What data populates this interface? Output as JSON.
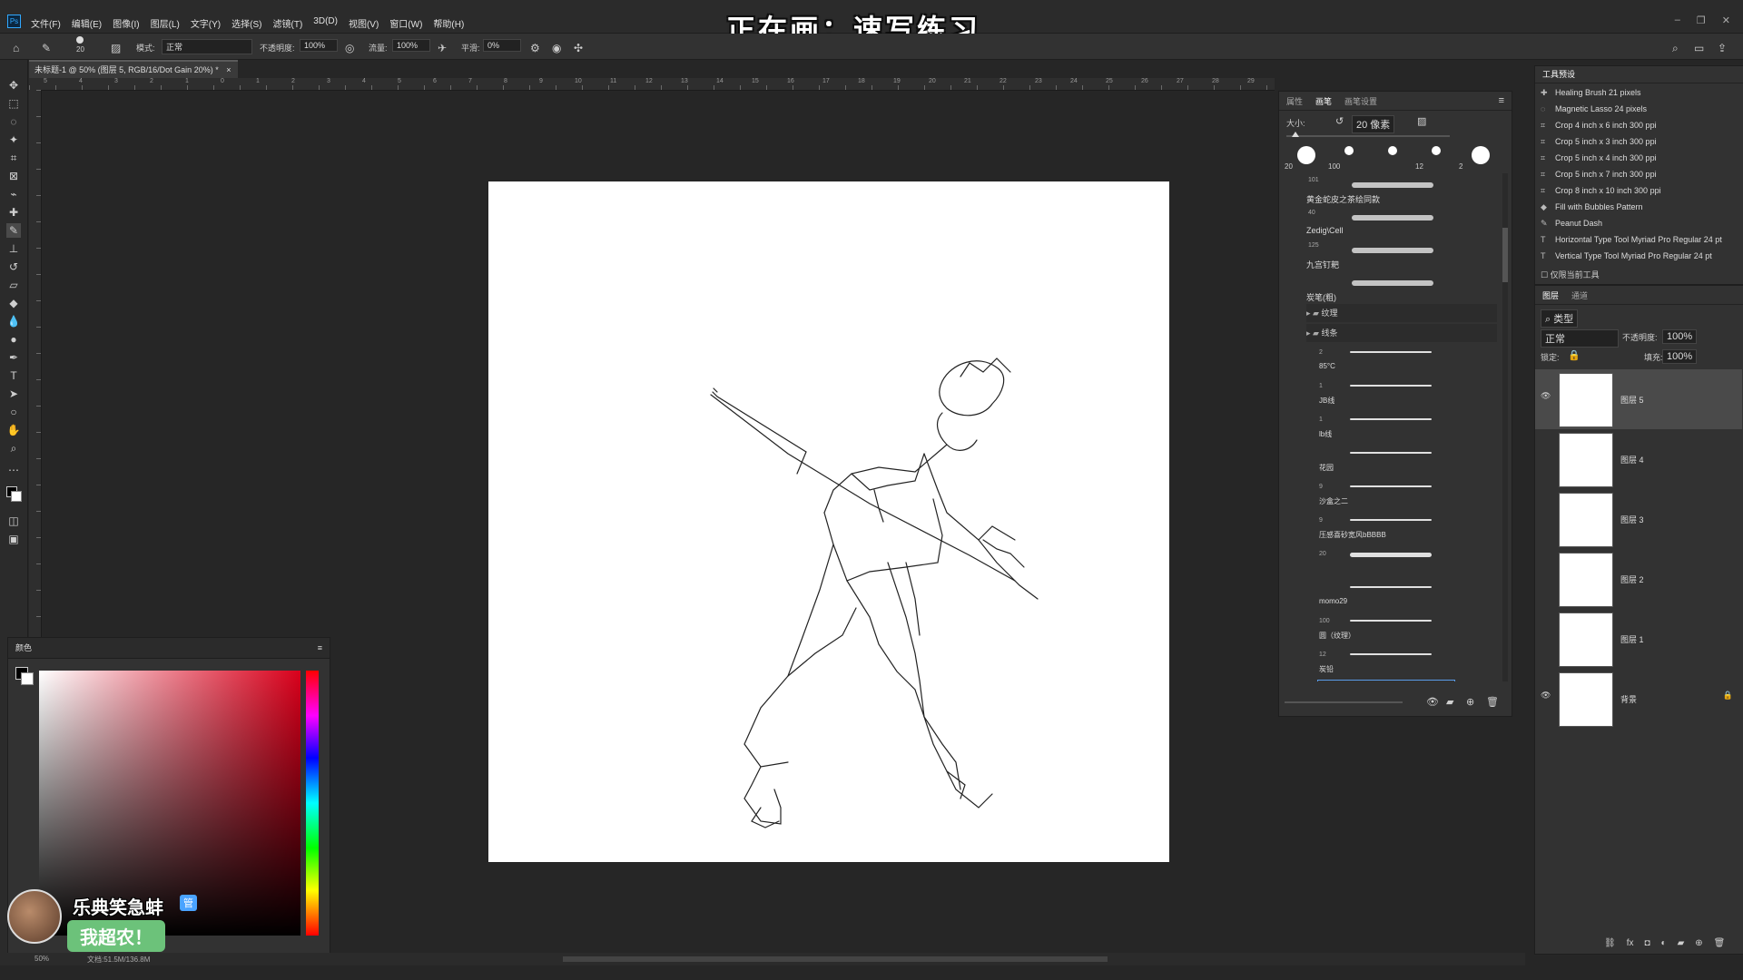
{
  "app": {
    "logo": "Ps"
  },
  "menu": [
    "文件(F)",
    "编辑(E)",
    "图像(I)",
    "图层(L)",
    "文字(Y)",
    "选择(S)",
    "滤镜(T)",
    "3D(D)",
    "视图(V)",
    "窗口(W)",
    "帮助(H)"
  ],
  "banner": "正在画：速写练习",
  "options": {
    "brush_size": "20",
    "mode_label": "模式:",
    "mode_value": "正常",
    "opacity_label": "不透明度:",
    "opacity_value": "100%",
    "flow_label": "流量:",
    "flow_value": "100%",
    "smooth_label": "平滑:",
    "smooth_value": "0%"
  },
  "document": {
    "tab_title": "未标题-1 @ 50% (图层 5, RGB/16/Dot Gain 20%) *"
  },
  "ruler_labels": [
    "5",
    "4",
    "3",
    "2",
    "1",
    "0",
    "1",
    "2",
    "3",
    "4",
    "5",
    "6",
    "7",
    "8",
    "9",
    "10",
    "11",
    "12",
    "13",
    "14",
    "15",
    "16",
    "17",
    "18",
    "19",
    "20",
    "21",
    "22",
    "23",
    "24",
    "25",
    "26",
    "27",
    "28",
    "29"
  ],
  "brushes_panel": {
    "tabs": [
      "属性",
      "画笔",
      "画笔设置"
    ],
    "size_label": "大小:",
    "size_value": "20 像素",
    "preset_sizes": [
      "20",
      "100",
      "",
      "12",
      "2"
    ],
    "groups": [
      {
        "num": "101",
        "name": "黄金蛇皮之茶绘同款"
      },
      {
        "num": "40",
        "name": "Zedig\\Cell"
      },
      {
        "num": "125",
        "name": "九宫钉耙"
      },
      {
        "num": "",
        "name": "炭笔(粗)"
      }
    ],
    "folders": [
      "纹理",
      "线条"
    ],
    "line_brushes": [
      {
        "num": "2",
        "name": "85°C"
      },
      {
        "num": "1",
        "name": "JB线"
      },
      {
        "num": "1",
        "name": "lb线"
      },
      {
        "num": "",
        "name": "花园"
      },
      {
        "num": "9",
        "name": "沙盒之二"
      },
      {
        "num": "9",
        "name": "压感喜砂宽风bBBBB"
      },
      {
        "num": "20",
        "name": ""
      },
      {
        "num": "",
        "name": "momo29"
      },
      {
        "num": "100",
        "name": "圆（纹理）"
      },
      {
        "num": "12",
        "name": "炭铅"
      },
      {
        "num": "20",
        "name": "1线条"
      }
    ]
  },
  "presets_panel": {
    "title": "工具预设",
    "items": [
      {
        "icon": "healing-brush-icon",
        "label": "Healing Brush 21 pixels"
      },
      {
        "icon": "magnetic-lasso-icon",
        "label": "Magnetic Lasso 24 pixels"
      },
      {
        "icon": "crop-icon",
        "label": "Crop 4 inch x 6 inch 300 ppi"
      },
      {
        "icon": "crop-icon",
        "label": "Crop 5 inch x 3 inch 300 ppi"
      },
      {
        "icon": "crop-icon",
        "label": "Crop 5 inch x 4 inch 300 ppi"
      },
      {
        "icon": "crop-icon",
        "label": "Crop 5 inch x 7 inch 300 ppi"
      },
      {
        "icon": "crop-icon",
        "label": "Crop 8 inch x 10 inch 300 ppi"
      },
      {
        "icon": "paint-bucket-icon",
        "label": "Fill with Bubbles Pattern"
      },
      {
        "icon": "pencil-icon",
        "label": "Peanut Dash"
      },
      {
        "icon": "type-icon",
        "label": "Horizontal Type Tool Myriad Pro Regular 24 pt"
      },
      {
        "icon": "type-icon",
        "label": "Vertical Type Tool Myriad Pro Regular 24 pt"
      }
    ],
    "current_only": "仅限当前工具"
  },
  "layers_panel": {
    "tabs": [
      "图层",
      "通道"
    ],
    "filter_label": "类型",
    "blend_mode": "正常",
    "opacity_label": "不透明度:",
    "opacity_value": "100%",
    "lock_label": "锁定:",
    "fill_label": "填充:",
    "fill_value": "100%",
    "layers": [
      {
        "name": "图层 5",
        "visible": true,
        "selected": true
      },
      {
        "name": "图层 4",
        "visible": false,
        "selected": false
      },
      {
        "name": "图层 3",
        "visible": false,
        "selected": false
      },
      {
        "name": "图层 2",
        "visible": false,
        "selected": false
      },
      {
        "name": "图层 1",
        "visible": false,
        "selected": false
      },
      {
        "name": "背景",
        "visible": true,
        "selected": false,
        "locked": true
      }
    ]
  },
  "color_panel": {
    "title": "颜色",
    "accent": "#d9001b"
  },
  "status": {
    "zoom": "50%",
    "doc": "文档:51.5M/136.8M"
  },
  "streamer": {
    "name": "乐典笑急蚌",
    "badge": "管",
    "message": "我超农！"
  }
}
